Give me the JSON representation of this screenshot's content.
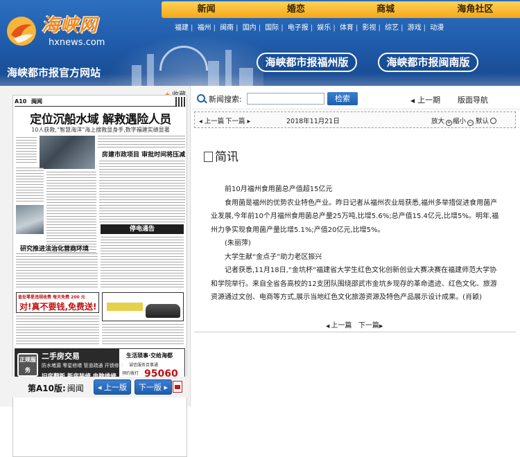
{
  "header": {
    "logo_title": "海峡网",
    "logo_url": "hxnews.com",
    "site_title": "海峡都市报官方网站",
    "nav": [
      "新闻",
      "婚恋",
      "商城",
      "海角社区"
    ],
    "subnav": [
      "福建",
      "福州",
      "闽南",
      "国内",
      "国际",
      "电子报",
      "娱乐",
      "体育",
      "影视",
      "综艺",
      "游戏",
      "动漫"
    ],
    "edition_buttons": [
      "海峡都市报福州版",
      "海峡都市报闽南版"
    ],
    "colors": {
      "header_blue": "#1f5aa8",
      "nav_orange": "#f3a819",
      "logo_orange": "#f28a1e"
    }
  },
  "left": {
    "favorite_label": "收藏",
    "page_thumb": {
      "page_no": "A10",
      "section": "闽闻",
      "headline": "定位沉船水域 解救遇险人员",
      "subhead": "10人获救,“智慧海洋”海上搜救显身手,数字福建实绩显著",
      "headline_2": "房建市政项目 审批时间将压减",
      "stop_notice": "停电通告",
      "headline_3": "研究推进法治化营商环境",
      "ad_red_top": "查处零星违规收费 每天免费 200 元",
      "ad_red_main": "对!真不要钱,免费送!",
      "classified": {
        "badge": "正规服务",
        "title": "二手房交易",
        "line1": "防水堵漏 零星修缮 管道疏通 开锁修锁",
        "line2": "旧房翻新 新房装修 电脑维修",
        "right_title": "生活琐事·交给海都",
        "right_note": "诚信服务百事通",
        "right_label": "预约拨打",
        "phone": "95060"
      }
    },
    "footer": {
      "page_label": "第A10版:",
      "page_name": "闽闻",
      "prev_button": "上一版",
      "next_button": "下一版"
    }
  },
  "right": {
    "search": {
      "label": "新闻搜索:",
      "value": "",
      "button": "检索"
    },
    "prev_issue": "上一期",
    "layout_nav": "版面导航",
    "toolbar": {
      "prev": "上一篇",
      "next": "下一篇",
      "date": "2018年11月21日",
      "zoom_in": "放大",
      "zoom_out": "缩小",
      "zoom_default": "默认"
    },
    "article": {
      "title": "简讯",
      "p1": "前10月福州食用菌总产值超15亿元",
      "p2": "食用菌是福州的优势农业特色产业。昨日记者从福州农业局获悉,福州多举措促进食用菌产业发展,今年前10个月福州食用菌总产量25万吨,比增5.6%;总产值15.4亿元,比增5%。明年,福州力争实现食用菌产量比增5.1%;产值20亿元,比增5%。",
      "p3": "(朱丽萍)",
      "p4": "大学生献“金点子”助力老区振兴",
      "p5": "记者获悉,11月18日,“金坑杯”福建省大学生红色文化创新创业大赛决赛在福建师范大学协和学院举行。来自全省各高校的12支团队围绕邵武市金坑乡现存的革命遗迹、红色文化、旅游资源通过文创、电商等方式,展示当地红色文化旅游资源及特色产品展示设计成果。(肖颖)"
    },
    "bottom_nav": {
      "prev": "上一篇",
      "next": "下一篇"
    }
  }
}
